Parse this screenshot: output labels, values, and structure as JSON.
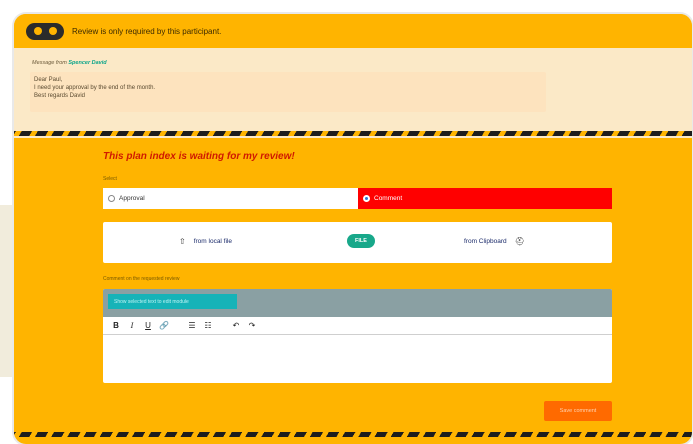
{
  "topbar": {
    "text": "Review is only required by this participant."
  },
  "message": {
    "from_label": "Message from",
    "from_name": "Spencer David",
    "lines": [
      "Dear Paul,",
      "I need your approval by the end of the month.",
      "Best regards David"
    ]
  },
  "review": {
    "heading": "This plan index is waiting for my review!",
    "select_label": "Select",
    "options": {
      "approval": "Approval",
      "comment": "Comment"
    },
    "selected": "comment"
  },
  "upload": {
    "local_label": "from local file",
    "file_badge": "FILE",
    "clipboard_label": "from Clipboard"
  },
  "comment": {
    "label": "Comment on the requested review",
    "selected_text_button": "Show selected text to edit module",
    "toolbar": {
      "bold": "B",
      "italic": "I",
      "underline": "U",
      "link": "🔗",
      "bullet_list": "☰",
      "numbered_list": "☷",
      "undo": "↶",
      "redo": "↷"
    }
  },
  "actions": {
    "save": "Save comment"
  },
  "icons": {
    "upload": "upload-icon",
    "clipboard": "clipboard-person-icon"
  },
  "colors": {
    "accent": "#ffb400",
    "comment_selected": "#ff0000",
    "file_badge": "#18a88a",
    "save_button": "#ff6a00"
  }
}
